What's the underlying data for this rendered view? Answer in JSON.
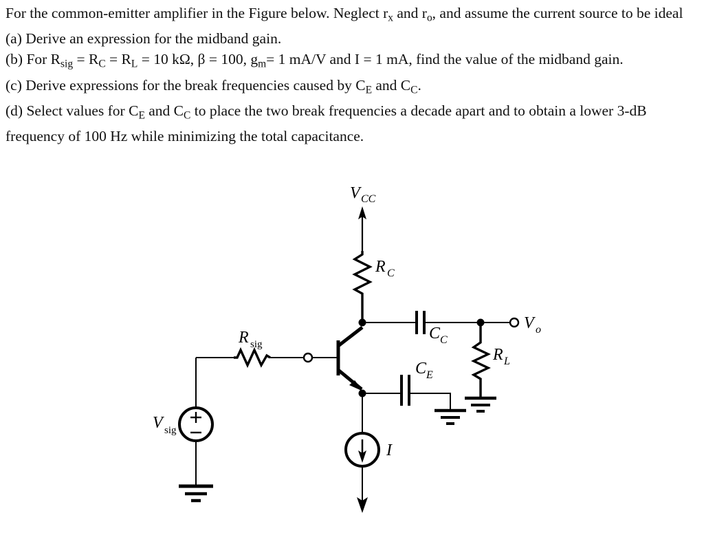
{
  "problem": {
    "intro_line1_a": "For the common-emitter amplifier in the Figure below. Neglect r",
    "intro_line1_sub1": "x",
    "intro_line1_b": " and r",
    "intro_line1_sub2": "o",
    "intro_line1_c": ", and assume the current source to be ideal",
    "part_a": "(a) Derive an expression for the midband gain.",
    "part_b_a": "(b) For R",
    "part_b_sub1": "sig",
    "part_b_b": " = R",
    "part_b_sub2": "C",
    "part_b_c": " = R",
    "part_b_sub3": "L",
    "part_b_d": " = 10 kΩ, β = 100, g",
    "part_b_sub4": "m",
    "part_b_e": "= 1 mA/V and I = 1 mA, find the value of the midband   gain.",
    "part_c_a": "(c) Derive expressions for the break frequencies caused by C",
    "part_c_sub1": "E",
    "part_c_b": " and C",
    "part_c_sub2": "C",
    "part_c_c": ".",
    "part_d_a": "(d) Select values for C",
    "part_d_sub1": "E",
    "part_d_b": " and C",
    "part_d_sub2": "C",
    "part_d_c": " to place the two break frequencies a decade apart and to obtain a lower 3-dB frequency of 100 Hz while minimizing the total capacitance."
  },
  "circuit": {
    "title": "common-emitter-amplifier-schematic",
    "labels": {
      "vcc": "V",
      "vcc_sub": "CC",
      "rc": "R",
      "rc_sub": "C",
      "rsig": "R",
      "rsig_sub": "sig",
      "rl": "R",
      "rl_sub": "L",
      "cc": "C",
      "cc_sub": "C",
      "ce": "C",
      "ce_sub": "E",
      "vo": "V",
      "vo_sub": "o",
      "vsig": "V",
      "vsig_sub": "sig",
      "current_source": "I",
      "plus": "+",
      "minus": "−"
    },
    "components": [
      {
        "name": "supply-rail-vcc",
        "type": "supply",
        "label": "VCC"
      },
      {
        "name": "resistor-rc",
        "type": "resistor",
        "label": "RC"
      },
      {
        "name": "resistor-rsig",
        "type": "resistor",
        "label": "Rsig"
      },
      {
        "name": "resistor-rl",
        "type": "resistor",
        "label": "RL"
      },
      {
        "name": "capacitor-cc",
        "type": "capacitor",
        "label": "CC"
      },
      {
        "name": "capacitor-ce",
        "type": "capacitor",
        "label": "CE"
      },
      {
        "name": "transistor-npn-q1",
        "type": "bjt-npn",
        "label": ""
      },
      {
        "name": "current-source-i",
        "type": "current-source",
        "label": "I"
      },
      {
        "name": "voltage-source-vsig",
        "type": "voltage-source",
        "label": "Vsig"
      },
      {
        "name": "output-terminal-vo",
        "type": "terminal",
        "label": "Vo"
      },
      {
        "name": "ground-vsig",
        "type": "ground",
        "label": ""
      },
      {
        "name": "ground-ce",
        "type": "ground",
        "label": ""
      },
      {
        "name": "ground-rl",
        "type": "ground",
        "label": ""
      }
    ]
  }
}
